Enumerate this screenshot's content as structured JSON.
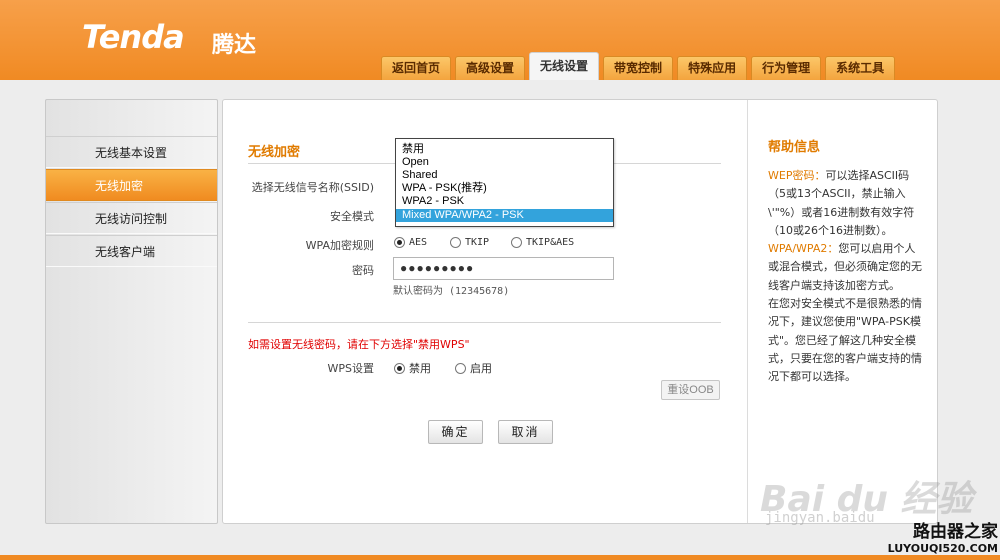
{
  "brand": {
    "logo": "Tenda",
    "logo_cn": "腾达"
  },
  "nav": {
    "tabs": [
      {
        "label": "返回首页"
      },
      {
        "label": "高级设置"
      },
      {
        "label": "无线设置",
        "active": true
      },
      {
        "label": "带宽控制"
      },
      {
        "label": "特殊应用"
      },
      {
        "label": "行为管理"
      },
      {
        "label": "系统工具"
      }
    ]
  },
  "sidebar": {
    "items": [
      {
        "label": "无线基本设置"
      },
      {
        "label": "无线加密",
        "active": true
      },
      {
        "label": "无线访问控制"
      },
      {
        "label": "无线客户端"
      }
    ]
  },
  "form": {
    "title": "无线加密",
    "ssid_label": "选择无线信号名称(SSID)",
    "security_label": "安全模式",
    "security_options": [
      "禁用",
      "Open",
      "Shared",
      "WPA - PSK(推荐)",
      "WPA2 - PSK",
      "Mixed WPA/WPA2 - PSK"
    ],
    "security_selected": "Mixed WPA/WPA2 - PSK",
    "wpa_rule_label": "WPA加密规则",
    "wpa_rules": [
      {
        "label": "AES",
        "checked": true
      },
      {
        "label": "TKIP",
        "checked": false
      },
      {
        "label": "TKIP&AES",
        "checked": false
      }
    ],
    "password_label": "密码",
    "password_value": "●●●●●●●●●",
    "password_hint": "默认密码为 (12345678)",
    "wps_note": "如需设置无线密码，请在下方选择\"禁用WPS\"",
    "wps_label": "WPS设置",
    "wps_options": [
      {
        "label": "禁用",
        "checked": true
      },
      {
        "label": "启用",
        "checked": false
      }
    ],
    "reset_oob": "重设OOB",
    "ok": "确定",
    "cancel": "取消"
  },
  "help": {
    "title": "帮助信息",
    "wep_key": "WEP密码：",
    "wep_text": "可以选择ASCII码（5或13个ASCII，禁止输入\\'\"%）或者16进制数有效字符（10或26个16进制数）。",
    "wpa_key": "WPA/WPA2：",
    "wpa_text": "您可以启用个人或混合模式，但必须确定您的无线客户端支持该加密方式。",
    "tip_text": "在您对安全模式不是很熟悉的情况下，建议您使用\"WPA-PSK模式\"。您已经了解这几种安全模式，只要在您的客户端支持的情况下都可以选择。"
  },
  "watermark": {
    "baidu": "Bai du 经验",
    "url": "jingyan.baidu",
    "router_cn": "路由器之家",
    "router_url": "LUYOUQI520.COM"
  }
}
